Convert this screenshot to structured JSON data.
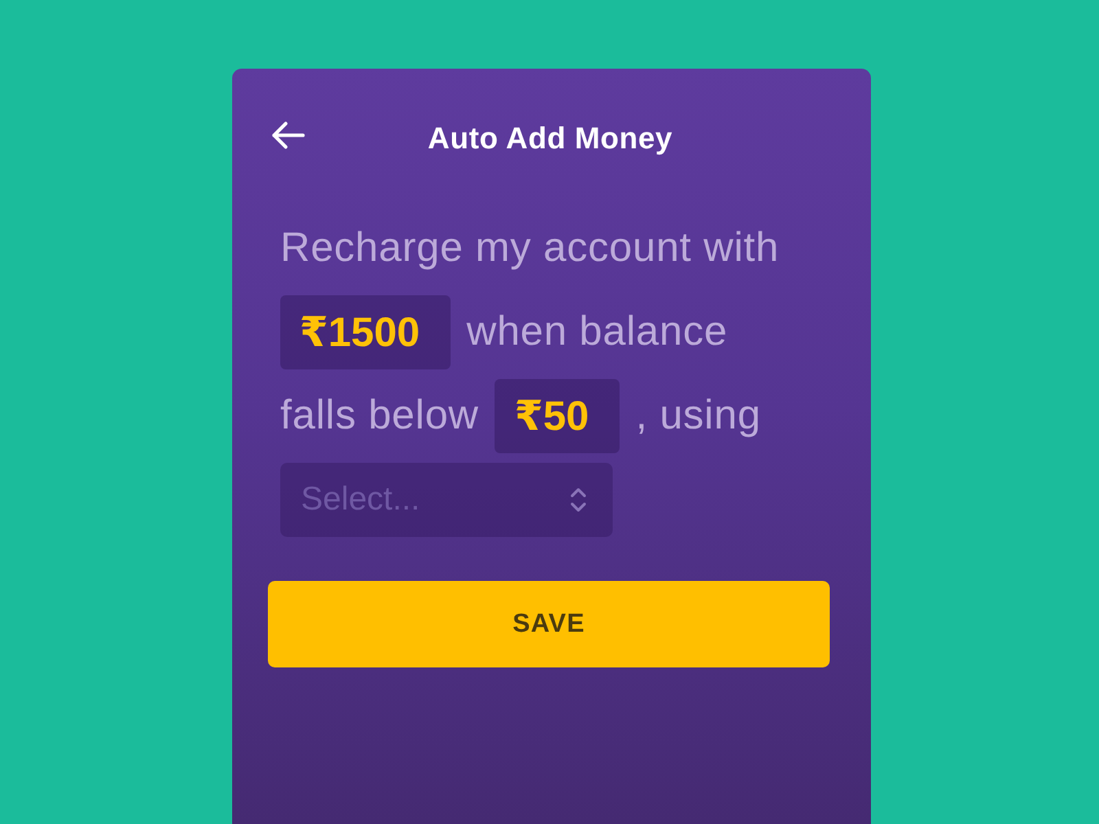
{
  "header": {
    "title": "Auto Add Money"
  },
  "form": {
    "parts": [
      {
        "kind": "text",
        "text": "Recharge my account with"
      },
      {
        "kind": "amount",
        "value": "₹1500"
      },
      {
        "kind": "text",
        "text": "when balance"
      },
      {
        "kind": "text",
        "text": "falls below"
      },
      {
        "kind": "amount",
        "value": "₹50"
      },
      {
        "kind": "text",
        "text": ", using"
      },
      {
        "kind": "select",
        "placeholder": "Select..."
      }
    ]
  },
  "save_button": {
    "label": "SAVE"
  }
}
